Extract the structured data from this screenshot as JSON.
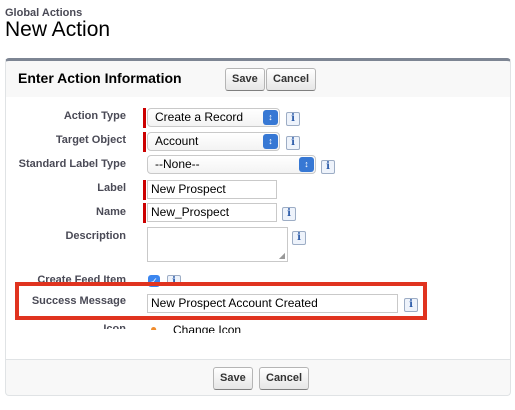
{
  "header": {
    "breadcrumb": "Global Actions",
    "title": "New Action"
  },
  "section": {
    "title": "Enter Action Information",
    "save_label": "Save",
    "cancel_label": "Cancel"
  },
  "fields": {
    "action_type": {
      "label": "Action Type",
      "value": "Create a Record"
    },
    "target_object": {
      "label": "Target Object",
      "value": "Account"
    },
    "standard_label_type": {
      "label": "Standard Label Type",
      "value": "--None--"
    },
    "label": {
      "label": "Label",
      "value": "New Prospect"
    },
    "name": {
      "label": "Name",
      "value": "New_Prospect"
    },
    "description": {
      "label": "Description",
      "value": ""
    },
    "create_feed_item": {
      "label": "Create Feed Item",
      "checked": true
    },
    "success_message": {
      "label": "Success Message",
      "value": "New Prospect Account Created"
    },
    "icon": {
      "label": "Icon",
      "link": "Change Icon"
    }
  },
  "footer": {
    "save_label": "Save",
    "cancel_label": "Cancel"
  },
  "colors": {
    "required": "#cc0000",
    "highlight": "#e0331f",
    "select_arrow": "#3778d4",
    "checkbox": "#3b86ef"
  }
}
